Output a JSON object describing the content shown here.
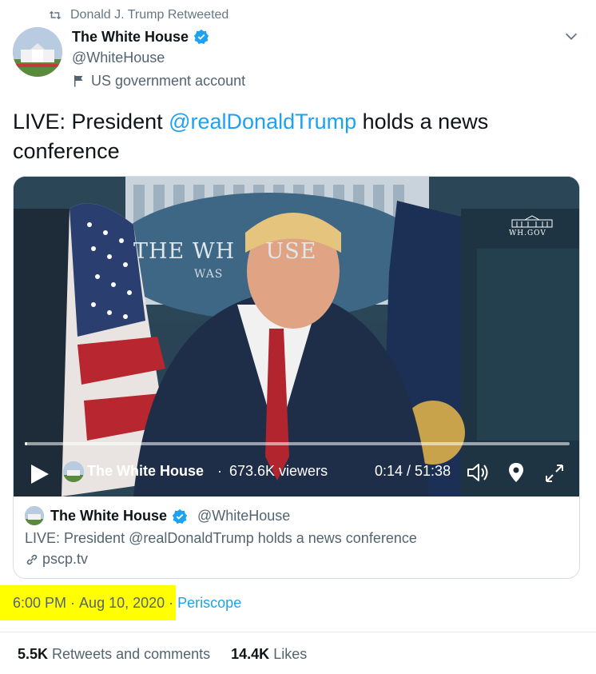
{
  "retweet": {
    "text": "Donald J. Trump Retweeted",
    "icon": "retweet-icon"
  },
  "author": {
    "name": "The White House",
    "handle": "@WhiteHouse",
    "label": "US government account",
    "verified_color": "#1da1f2"
  },
  "tweet": {
    "prefix": "LIVE: President ",
    "mention": "@realDonaldTrump",
    "suffix": " holds a news conference"
  },
  "video": {
    "watermark": "WH.GOV",
    "backdrop_text": "THE WH    USE",
    "backdrop_sub": "WAS",
    "broadcaster": "The White House",
    "separator": "·",
    "viewers": "673.6K viewers",
    "time": "0:14 / 51:38",
    "progress_fraction": 0.005
  },
  "card": {
    "name": "The White House",
    "handle": "@WhiteHouse",
    "text": "LIVE: President @realDonaldTrump holds a news conference",
    "link": "pscp.tv"
  },
  "meta": {
    "time": "6:00 PM",
    "sep1": " · ",
    "date": "Aug 10, 2020",
    "sep2": " · ",
    "source": "Periscope"
  },
  "stats": {
    "retweets_count": "5.5K",
    "retweets_label": "Retweets and comments",
    "likes_count": "14.4K",
    "likes_label": "Likes"
  },
  "colors": {
    "accent": "#1da1f2",
    "highlight": "#ffff00"
  }
}
